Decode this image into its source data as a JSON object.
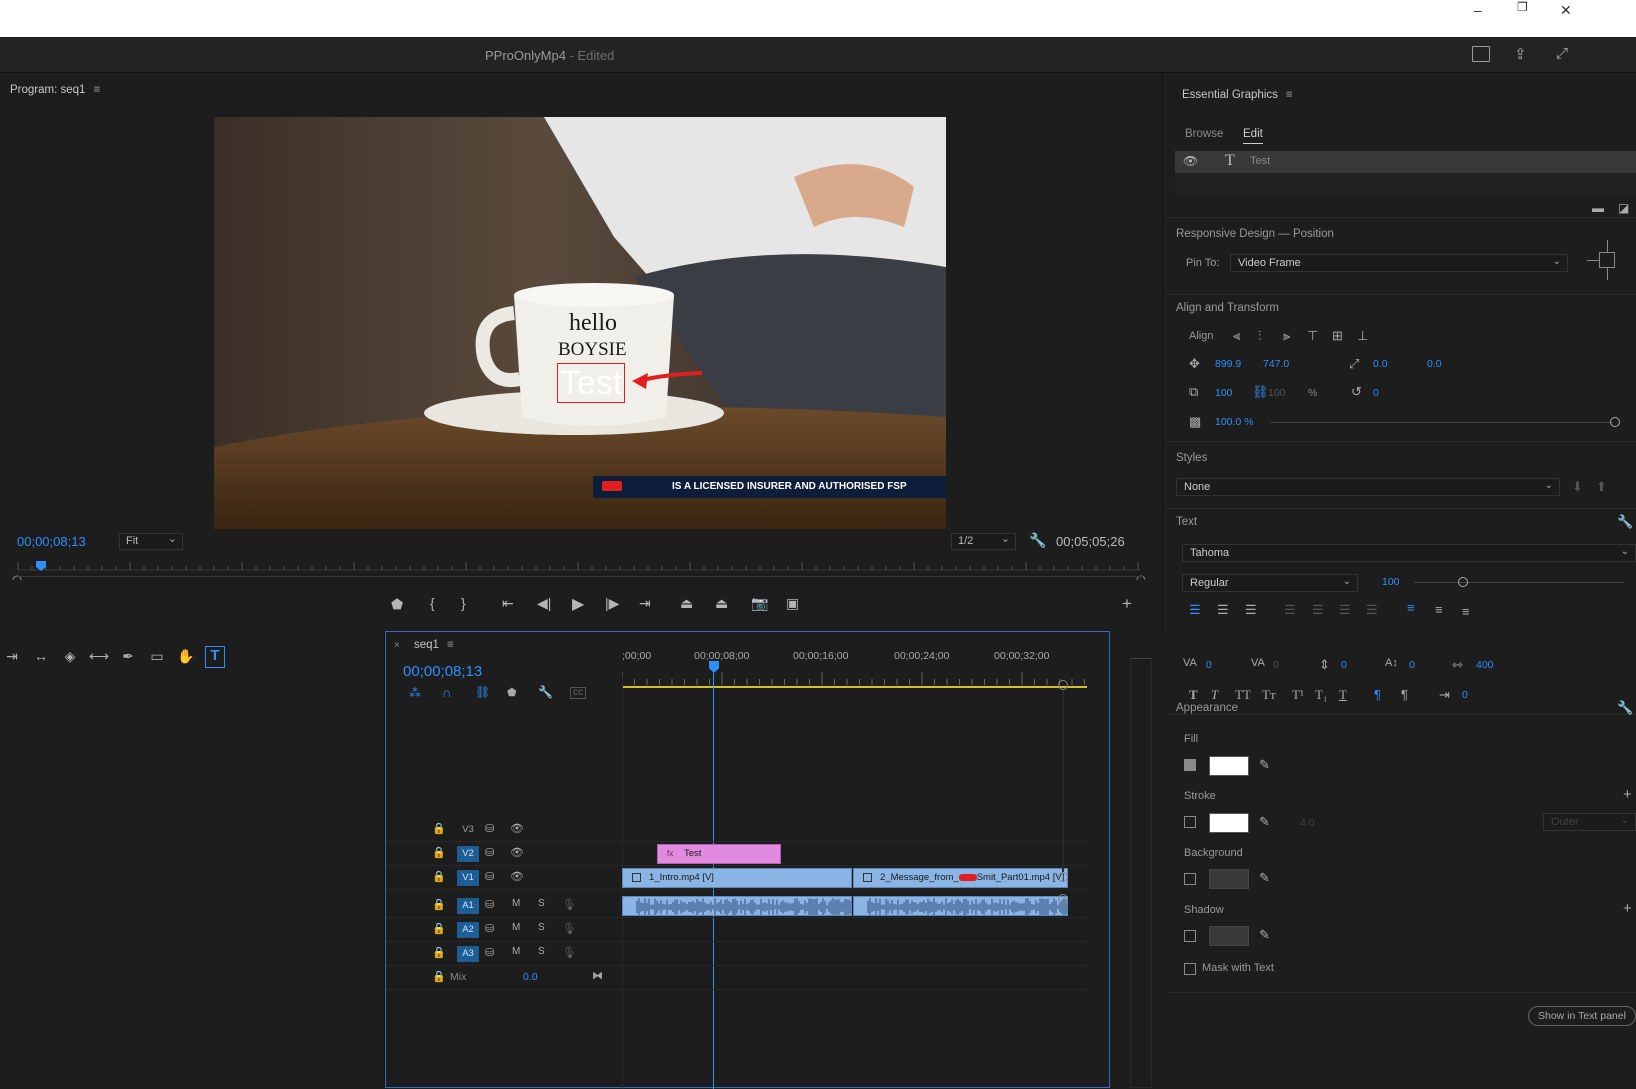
{
  "app": {
    "title": "PProOnlyMp4",
    "edited": "- Edited"
  },
  "program_monitor": {
    "title": "Program: seq1",
    "current_time": "00;00;08;13",
    "fit": "Fit",
    "resolution": "1/2",
    "duration": "00;05;05;26",
    "video_text": {
      "line1": "hello",
      "line2": "BOYSIE",
      "line3": "Test",
      "banner": "IS A LICENSED INSURER AND AUTHORISED FSP"
    }
  },
  "timeline": {
    "tab": "seq1",
    "close": "×",
    "current_time": "00;00;08;13",
    "ruler_labels": [
      ";00;00",
      "00;00;08;00",
      "00;00;16;00",
      "00;00;24;00",
      "00;00;32;00"
    ],
    "tracks": {
      "v3": "V3",
      "v2": "V2",
      "v1": "V1",
      "a1": "A1",
      "a2": "A2",
      "a3": "A3",
      "mix": "Mix",
      "mix_value": "0.0",
      "m": "M",
      "s": "S"
    },
    "clips": {
      "title": "Test",
      "v1a": "1_Intro.mp4 [V]",
      "v1b_pre": "2_Message_from_",
      "v1b_post": "Smit_Part01.mp4 [V]",
      "fx": "fx"
    }
  },
  "essential_graphics": {
    "title": "Essential Graphics",
    "tabs": {
      "browse": "Browse",
      "edit": "Edit"
    },
    "layer": "Test",
    "responsive": {
      "title": "Responsive Design — Position",
      "pin_label": "Pin To:",
      "pin_value": "Video Frame"
    },
    "align": {
      "title": "Align and Transform",
      "align_label": "Align",
      "pos_x": "899.9",
      "pos_y": "747.0",
      "anchor_x": "0.0",
      "anchor_y": "0.0",
      "scale": "100",
      "scale_h": "100",
      "scale_unit": "%",
      "rotation": "0",
      "opacity": "100.0 %"
    },
    "styles": {
      "title": "Styles",
      "value": "None"
    },
    "text": {
      "title": "Text",
      "font": "Tahoma",
      "weight": "Regular",
      "size": "100",
      "tracking": "0",
      "kerning": "0",
      "leading": "0",
      "baseline": "0",
      "tsume": "400",
      "indent": "0"
    },
    "appearance": {
      "title": "Appearance",
      "fill": "Fill",
      "stroke": "Stroke",
      "stroke_width": "4.0",
      "stroke_type": "Outer",
      "background": "Background",
      "shadow": "Shadow",
      "mask": "Mask with Text"
    },
    "show_text_panel": "Show in Text panel"
  },
  "colors": {
    "accent": "#2e8fff",
    "title_clip": "#e08ae0",
    "video_clip": "#8ab4e4",
    "playhead": "#2e8fff"
  }
}
